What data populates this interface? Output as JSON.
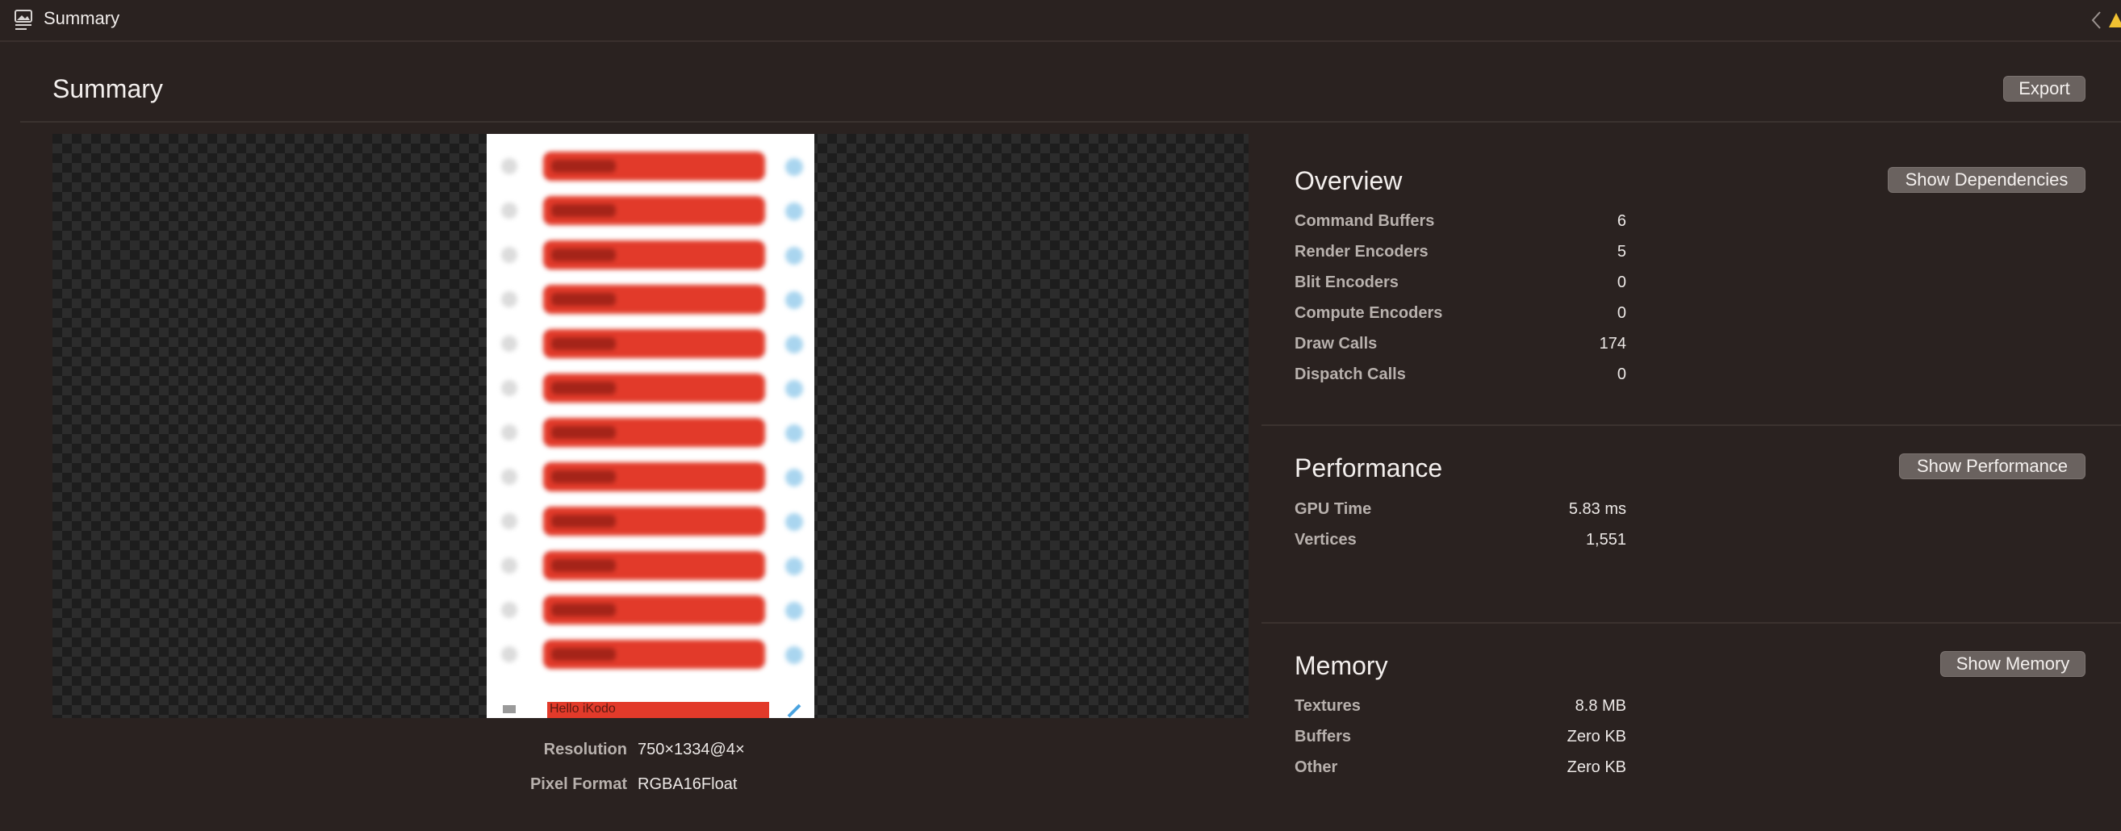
{
  "titlebar": {
    "title": "Summary"
  },
  "header": {
    "title": "Summary",
    "export_label": "Export"
  },
  "preview": {
    "last_cell_label": "Hello iKodo",
    "info": [
      {
        "label": "Resolution",
        "value": "750×1334@4×"
      },
      {
        "label": "Pixel Format",
        "value": "RGBA16Float"
      }
    ]
  },
  "overview": {
    "title": "Overview",
    "button": "Show Dependencies",
    "stats": [
      {
        "label": "Command Buffers",
        "value": "6"
      },
      {
        "label": "Render Encoders",
        "value": "5"
      },
      {
        "label": "Blit Encoders",
        "value": "0"
      },
      {
        "label": "Compute Encoders",
        "value": "0"
      },
      {
        "label": "Draw Calls",
        "value": "174"
      },
      {
        "label": "Dispatch Calls",
        "value": "0"
      }
    ]
  },
  "performance": {
    "title": "Performance",
    "button": "Show Performance",
    "stats": [
      {
        "label": "GPU Time",
        "value": "5.83 ms"
      },
      {
        "label": "Vertices",
        "value": "1,551"
      }
    ]
  },
  "memory": {
    "title": "Memory",
    "button": "Show Memory",
    "stats": [
      {
        "label": "Textures",
        "value": "8.8 MB"
      },
      {
        "label": "Buffers",
        "value": "Zero KB"
      },
      {
        "label": "Other",
        "value": "Zero KB"
      }
    ]
  },
  "colors": {
    "background": "#2a2220",
    "button": "#6a625f",
    "accent_red": "#e23a2a"
  }
}
